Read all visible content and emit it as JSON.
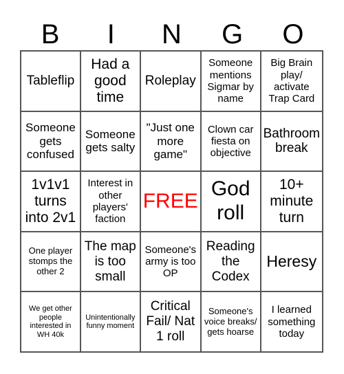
{
  "header": [
    "B",
    "I",
    "N",
    "G",
    "O"
  ],
  "free_color": "#ff0000",
  "cells": [
    [
      "Tableflip",
      "Had a good time",
      "Roleplay",
      "Someone mentions Sigmar by name",
      "Big Brain play/ activate Trap Card"
    ],
    [
      "Someone gets confused",
      "Someone gets salty",
      "\"Just one more game\"",
      "Clown car fiesta on objective",
      "Bathroom break"
    ],
    [
      "1v1v1 turns into 2v1",
      "Interest in other players' faction",
      "FREE",
      "God roll",
      "10+ minute turn"
    ],
    [
      "One player stomps the other 2",
      "The map is too small",
      "Someone's army is too OP",
      "Reading the Codex",
      "Heresy"
    ],
    [
      "We get other people interested in WH 40k",
      "Unintentionally funny moment",
      "Critical Fail/ Nat 1 roll",
      "Someone's voice breaks/ gets hoarse",
      "I learned something today"
    ]
  ]
}
